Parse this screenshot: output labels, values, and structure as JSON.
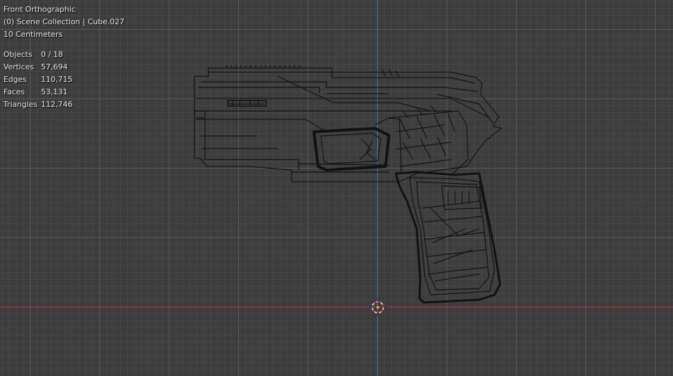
{
  "viewport": {
    "view_name": "Front Orthographic",
    "collection_info": "(0) Scene Collection | Cube.027",
    "scale_info": "10 Centimeters"
  },
  "stats": {
    "objects": {
      "label": "Objects",
      "value": "0 / 18"
    },
    "vertices": {
      "label": "Vertices",
      "value": "57,694"
    },
    "edges": {
      "label": "Edges",
      "value": "110,715"
    },
    "faces": {
      "label": "Faces",
      "value": "53,131"
    },
    "triangles": {
      "label": "Triangles",
      "value": "112,746"
    }
  },
  "colors": {
    "background": "#3d3d3d",
    "grid": "#5f5f5f",
    "axis_x": "#c33a43",
    "axis_z": "#3f7fc8",
    "wire": "#121212"
  },
  "icons": {
    "cursor": "3d-cursor-icon"
  }
}
